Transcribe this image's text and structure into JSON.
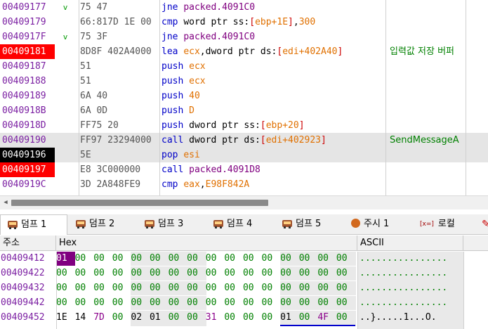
{
  "disasm": {
    "rows": [
      {
        "addr": "00409177",
        "addr_style": "normal",
        "jump": "v",
        "bytes": "75 47",
        "mn": "jne",
        "ops": [
          {
            "t": "addrtxt",
            "v": "packed.4091C0"
          }
        ],
        "comment": ""
      },
      {
        "addr": "00409179",
        "addr_style": "normal",
        "jump": "",
        "bytes": "66:817D 1E 00",
        "mn": "cmp",
        "ops": [
          {
            "t": "seg",
            "v": "word ptr ss:"
          },
          {
            "t": "brk",
            "v": "["
          },
          {
            "t": "reg",
            "v": "ebp+1E"
          },
          {
            "t": "brk",
            "v": "]"
          },
          {
            "t": "seg",
            "v": ","
          },
          {
            "t": "num",
            "v": "300"
          }
        ],
        "comment": ""
      },
      {
        "addr": "0040917F",
        "addr_style": "normal",
        "jump": "v",
        "bytes": "75 3F",
        "mn": "jne",
        "ops": [
          {
            "t": "addrtxt",
            "v": "packed.4091C0"
          }
        ],
        "comment": ""
      },
      {
        "addr": "00409181",
        "addr_style": "bp",
        "jump": "",
        "bytes": "8D8F 402A4000",
        "mn": "lea",
        "ops": [
          {
            "t": "reg",
            "v": "ecx"
          },
          {
            "t": "seg",
            "v": ",dword ptr ds:"
          },
          {
            "t": "brk",
            "v": "["
          },
          {
            "t": "reg",
            "v": "edi+402A40"
          },
          {
            "t": "brk",
            "v": "]"
          }
        ],
        "comment": "입력값 저장 버퍼"
      },
      {
        "addr": "00409187",
        "addr_style": "normal",
        "jump": "",
        "bytes": "51",
        "mn": "push",
        "ops": [
          {
            "t": "reg",
            "v": "ecx"
          }
        ],
        "comment": ""
      },
      {
        "addr": "00409188",
        "addr_style": "normal",
        "jump": "",
        "bytes": "51",
        "mn": "push",
        "ops": [
          {
            "t": "reg",
            "v": "ecx"
          }
        ],
        "comment": ""
      },
      {
        "addr": "00409189",
        "addr_style": "normal",
        "jump": "",
        "bytes": "6A 40",
        "mn": "push",
        "ops": [
          {
            "t": "num",
            "v": "40"
          }
        ],
        "comment": ""
      },
      {
        "addr": "0040918B",
        "addr_style": "normal",
        "jump": "",
        "bytes": "6A 0D",
        "mn": "push",
        "ops": [
          {
            "t": "num",
            "v": "D"
          }
        ],
        "comment": ""
      },
      {
        "addr": "0040918D",
        "addr_style": "normal",
        "jump": "",
        "bytes": "FF75 20",
        "mn": "push",
        "ops": [
          {
            "t": "seg",
            "v": "dword ptr ss:"
          },
          {
            "t": "brk",
            "v": "["
          },
          {
            "t": "reg",
            "v": "ebp+20"
          },
          {
            "t": "brk",
            "v": "]"
          }
        ],
        "comment": ""
      },
      {
        "addr": "00409190",
        "addr_style": "normal",
        "jump": "",
        "bytes": "FF97 23294000",
        "mn": "call",
        "ops": [
          {
            "t": "seg",
            "v": "dword ptr ds:"
          },
          {
            "t": "brk",
            "v": "["
          },
          {
            "t": "reg",
            "v": "edi+402923"
          },
          {
            "t": "brk",
            "v": "]"
          }
        ],
        "comment": "SendMessageA"
      },
      {
        "addr": "00409196",
        "addr_style": "cur",
        "jump": "",
        "bytes": "5E",
        "mn": "pop",
        "ops": [
          {
            "t": "reg",
            "v": "esi"
          }
        ],
        "comment": ""
      },
      {
        "addr": "00409197",
        "addr_style": "bp",
        "jump": "",
        "bytes": "E8 3C000000",
        "mn": "call",
        "ops": [
          {
            "t": "addrtxt",
            "v": "packed.4091D8"
          }
        ],
        "comment": ""
      },
      {
        "addr": "0040919C",
        "addr_style": "normal",
        "jump": "",
        "bytes": "3D 2A848FE9",
        "mn": "cmp",
        "ops": [
          {
            "t": "reg",
            "v": "eax"
          },
          {
            "t": "seg",
            "v": ","
          },
          {
            "t": "num",
            "v": "E98F842A"
          }
        ],
        "comment": ""
      }
    ]
  },
  "tabs": [
    {
      "icon": "bus-icon",
      "label": "덤프 1",
      "active": true
    },
    {
      "icon": "bus-icon",
      "label": "덤프 2",
      "active": false
    },
    {
      "icon": "bus-icon",
      "label": "덤프 3",
      "active": false
    },
    {
      "icon": "bus-icon",
      "label": "덤프 4",
      "active": false
    },
    {
      "icon": "bus-icon",
      "label": "덤프 5",
      "active": false
    },
    {
      "icon": "skull-icon",
      "label": "주시 1",
      "active": false
    },
    {
      "icon": "x-equals-icon",
      "icon_text": "[x=]",
      "label": "로컬",
      "active": false
    },
    {
      "icon": "pen-icon",
      "label": "",
      "active": false
    }
  ],
  "dump": {
    "headers": {
      "address": "주소",
      "hex": "Hex",
      "ascii": "ASCII"
    },
    "rows": [
      {
        "addr": "00409412",
        "bytes": [
          "01",
          "00",
          "00",
          "00",
          "00",
          "00",
          "00",
          "00",
          "00",
          "00",
          "00",
          "00",
          "00",
          "00",
          "00",
          "00"
        ],
        "ascii": "................"
      },
      {
        "addr": "00409422",
        "bytes": [
          "00",
          "00",
          "00",
          "00",
          "00",
          "00",
          "00",
          "00",
          "00",
          "00",
          "00",
          "00",
          "00",
          "00",
          "00",
          "00"
        ],
        "ascii": "................"
      },
      {
        "addr": "00409432",
        "bytes": [
          "00",
          "00",
          "00",
          "00",
          "00",
          "00",
          "00",
          "00",
          "00",
          "00",
          "00",
          "00",
          "00",
          "00",
          "00",
          "00"
        ],
        "ascii": "................"
      },
      {
        "addr": "00409442",
        "bytes": [
          "00",
          "00",
          "00",
          "00",
          "00",
          "00",
          "00",
          "00",
          "00",
          "00",
          "00",
          "00",
          "00",
          "00",
          "00",
          "00"
        ],
        "ascii": "................"
      },
      {
        "addr": "00409452",
        "bytes": [
          "1E",
          "14",
          "7D",
          "00",
          "02",
          "01",
          "00",
          "00",
          "31",
          "00",
          "00",
          "00",
          "01",
          "00",
          "4F",
          "00"
        ],
        "ascii": "..}.....1...O."
      }
    ]
  },
  "colors": {
    "breakpoint": "#ff0000",
    "current": "#000000",
    "address": "#7b1fa2",
    "mnemonic": "#0000c8",
    "register": "#e07000",
    "comment": "#008000"
  }
}
